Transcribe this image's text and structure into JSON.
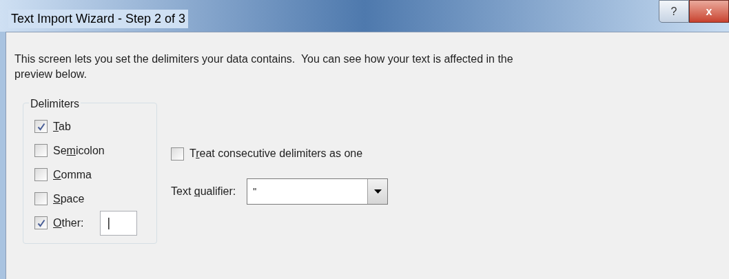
{
  "window": {
    "title": "Text Import Wizard - Step 2 of 3",
    "help_button": "?",
    "close_button": "x"
  },
  "instructions": "This screen lets you set the delimiters your data contains.  You can see how your text is affected in the preview below.",
  "delimiters": {
    "title": "Delimiters",
    "items": [
      {
        "label": [
          {
            "text": "T",
            "underline": true
          },
          {
            "text": "ab",
            "underline": false
          }
        ],
        "checked": true
      },
      {
        "label": [
          {
            "text": "Se",
            "underline": false
          },
          {
            "text": "m",
            "underline": true
          },
          {
            "text": "icolon",
            "underline": false
          }
        ],
        "checked": false
      },
      {
        "label": [
          {
            "text": "C",
            "underline": true
          },
          {
            "text": "omma",
            "underline": false
          }
        ],
        "checked": false
      },
      {
        "label": [
          {
            "text": "S",
            "underline": true
          },
          {
            "text": "pace",
            "underline": false
          }
        ],
        "checked": false
      },
      {
        "label": [
          {
            "text": "O",
            "underline": true
          },
          {
            "text": "ther:",
            "underline": false
          }
        ],
        "checked": true,
        "value": "|"
      }
    ]
  },
  "consecutive": {
    "label": [
      {
        "text": "T",
        "underline": false
      },
      {
        "text": "r",
        "underline": true
      },
      {
        "text": "eat consecutive delimiters as one",
        "underline": false
      }
    ],
    "checked": false
  },
  "qualifier": {
    "label": [
      {
        "text": "Text ",
        "underline": false
      },
      {
        "text": "q",
        "underline": true
      },
      {
        "text": "ualifier:",
        "underline": false
      }
    ],
    "value": "\""
  }
}
